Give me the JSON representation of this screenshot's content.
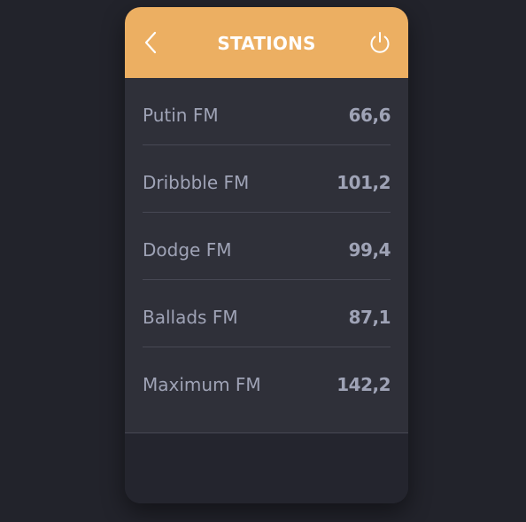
{
  "header": {
    "title": "STATIONS",
    "back_icon": "chevron-left-icon",
    "power_icon": "power-icon"
  },
  "stations": [
    {
      "name": "Putin FM",
      "frequency": "66,6"
    },
    {
      "name": "Dribbble FM",
      "frequency": "101,2"
    },
    {
      "name": "Dodge FM",
      "frequency": "99,4"
    },
    {
      "name": "Ballads FM",
      "frequency": "87,1"
    },
    {
      "name": "Maximum FM",
      "frequency": "142,2"
    }
  ],
  "colors": {
    "background": "#22232b",
    "card": "#2f3039",
    "header": "#ecaf62",
    "text": "#9fa3b6",
    "divider": "#474854",
    "footer": "#24252e"
  }
}
